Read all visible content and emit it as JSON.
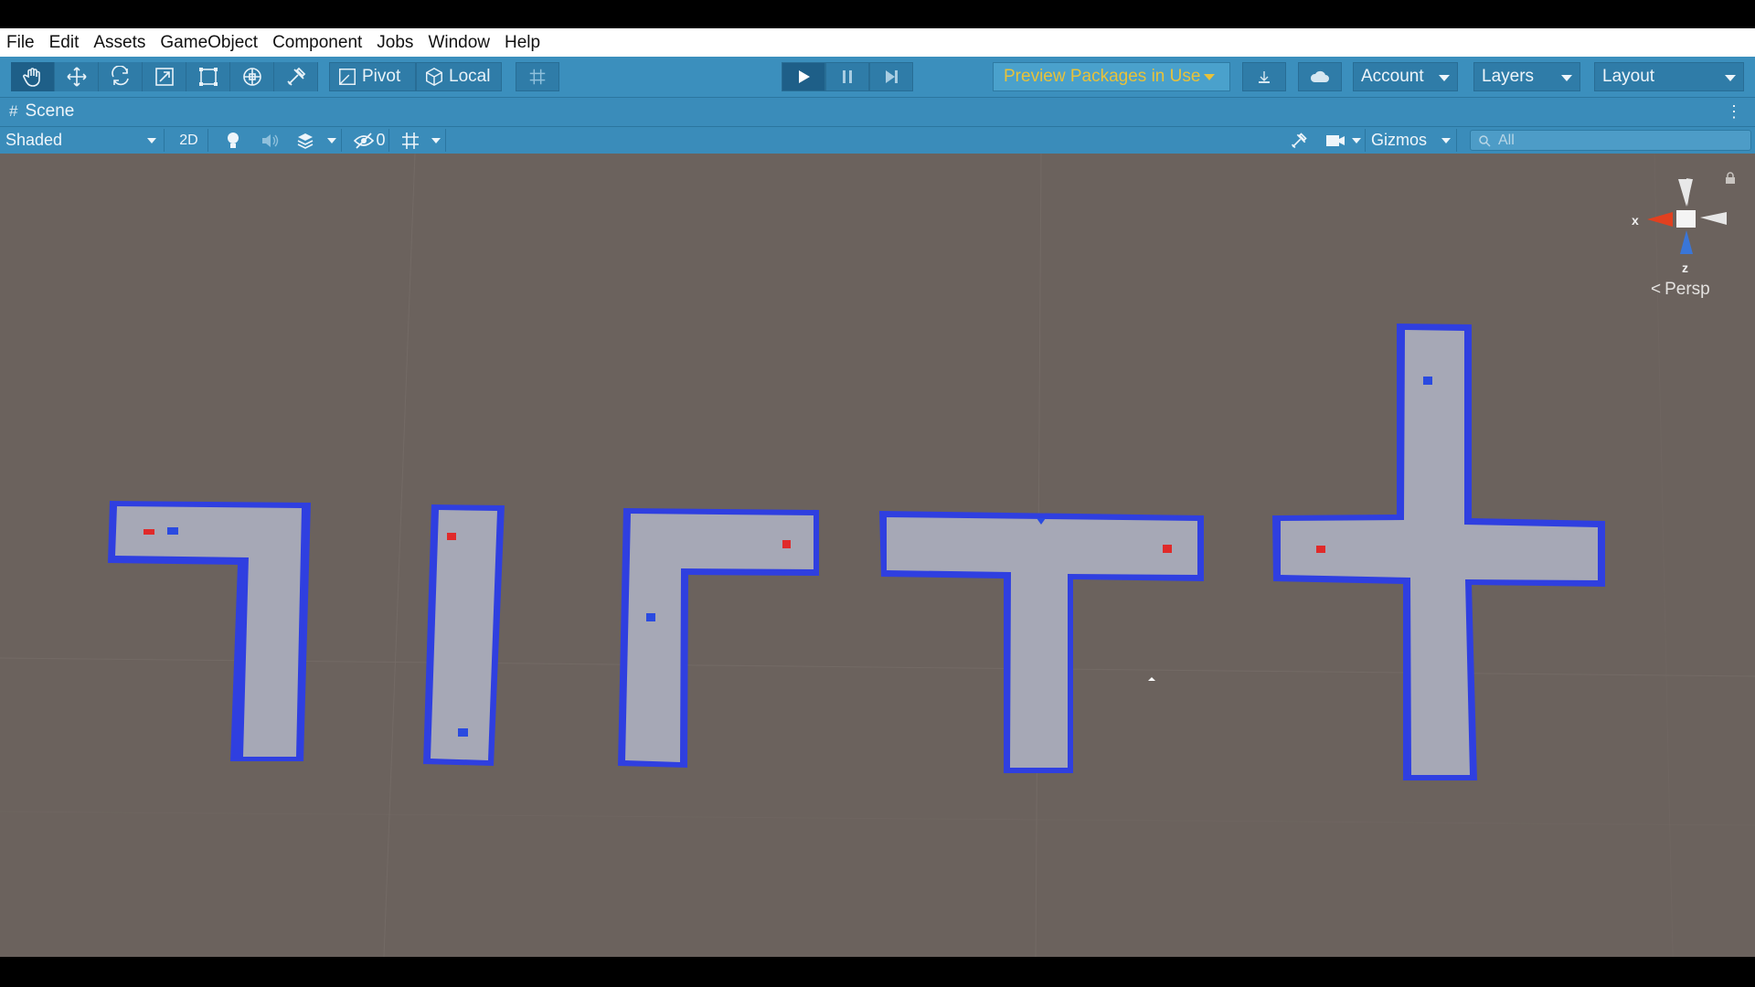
{
  "menu": [
    "File",
    "Edit",
    "Assets",
    "GameObject",
    "Component",
    "Jobs",
    "Window",
    "Help"
  ],
  "toolbar": {
    "tools": [
      "hand-tool",
      "move-tool",
      "rotate-tool",
      "scale-tool",
      "rect-tool",
      "transform-tool",
      "custom-tool"
    ],
    "pivot_label": "Pivot",
    "local_label": "Local",
    "preview_packages_label": "Preview Packages in Use",
    "account_label": "Account",
    "layers_label": "Layers",
    "layout_label": "Layout"
  },
  "scene_tab": {
    "title": "Scene"
  },
  "scene_options": {
    "draw_mode": "Shaded",
    "mode_2d": "2D",
    "hidden_count": "0",
    "gizmos_label": "Gizmos",
    "search_placeholder": "All"
  },
  "viewport": {
    "gizmo_axis_x": "x",
    "gizmo_axis_z": "z",
    "projection_label": "Persp"
  },
  "colors": {
    "toolbar": "#3b8fbd",
    "viewport_bg": "#6b625d",
    "floor": "#a6a8b6",
    "wall": "#2f3fe0",
    "agent_red": "#e02a2a",
    "target_blue": "#2a4ae0",
    "preview_text": "#e8c23a"
  }
}
